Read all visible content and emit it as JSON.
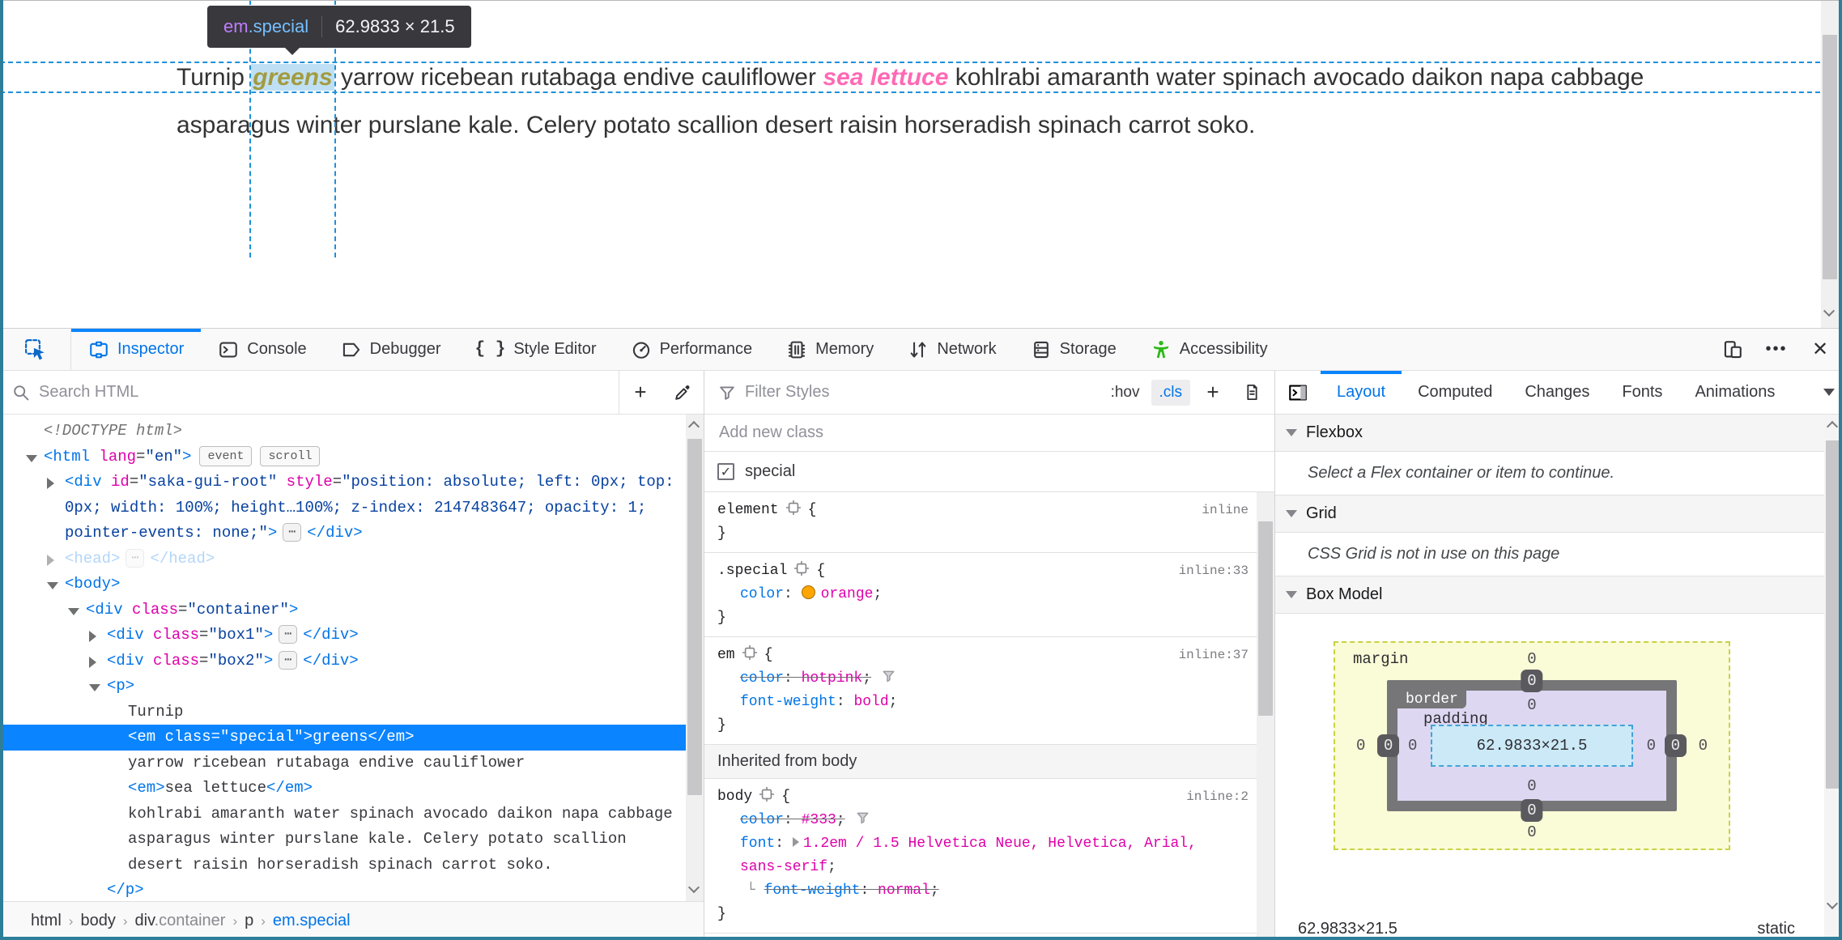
{
  "page": {
    "tooltip": {
      "tag": "em",
      "class": ".special",
      "dims": "62.9833 × 21.5"
    },
    "paragraph": {
      "t1": "Turnip ",
      "em_special": "greens",
      "t2": " yarrow ricebean rutabaga endive cauliflower ",
      "em_plain": "sea lettuce",
      "t3": " kohlrabi amaranth water spinach avocado daikon napa cabbage asparagus winter purslane kale. Celery potato scallion desert raisin horseradish spinach carrot soko."
    }
  },
  "toolbox": {
    "tabs": [
      {
        "icon": "inspector-icon",
        "label": "Inspector",
        "active": true
      },
      {
        "icon": "console-icon",
        "label": "Console"
      },
      {
        "icon": "debugger-icon",
        "label": "Debugger"
      },
      {
        "icon": "style-editor-icon",
        "label": "Style Editor"
      },
      {
        "icon": "performance-icon",
        "label": "Performance"
      },
      {
        "icon": "memory-icon",
        "label": "Memory"
      },
      {
        "icon": "network-icon",
        "label": "Network"
      },
      {
        "icon": "storage-icon",
        "label": "Storage"
      },
      {
        "icon": "accessibility-icon",
        "label": "Accessibility"
      }
    ]
  },
  "markup": {
    "search_placeholder": "Search HTML",
    "tree": [
      {
        "indent": 0,
        "tokens": [
          {
            "t": "doctype",
            "s": "<!DOCTYPE html>"
          }
        ]
      },
      {
        "indent": 0,
        "arrow": "down",
        "tokens": [
          {
            "t": "tag",
            "s": "<html"
          },
          {
            "t": "attr",
            "s": " lang"
          },
          {
            "t": "eq",
            "s": "="
          },
          {
            "t": "val",
            "s": "\"en\""
          },
          {
            "t": "tag",
            "s": ">"
          },
          {
            "t": "badge",
            "s": "event"
          },
          {
            "t": "badge",
            "s": "scroll"
          }
        ]
      },
      {
        "indent": 1,
        "arrow": "right",
        "tokens": [
          {
            "t": "tag",
            "s": "<div"
          },
          {
            "t": "attr",
            "s": " id"
          },
          {
            "t": "eq",
            "s": "="
          },
          {
            "t": "val",
            "s": "\"saka-gui-root\""
          },
          {
            "t": "attr",
            "s": " style"
          },
          {
            "t": "eq",
            "s": "="
          },
          {
            "t": "val",
            "s": "\"position: absolute; left: 0px; top: 0px; width: 100%; height…100%; z-index: 2147483647; opacity: 1; pointer-events: none;\""
          },
          {
            "t": "tag",
            "s": ">"
          },
          {
            "t": "ellipsis",
            "s": "⋯"
          },
          {
            "t": "tag",
            "s": "</div>"
          }
        ]
      },
      {
        "indent": 1,
        "arrow": "right",
        "dim": true,
        "tokens": [
          {
            "t": "tag",
            "s": "<head>"
          },
          {
            "t": "ellipsis",
            "s": "⋯"
          },
          {
            "t": "tag",
            "s": "</head>"
          }
        ]
      },
      {
        "indent": 1,
        "arrow": "down",
        "tokens": [
          {
            "t": "tag",
            "s": "<body>"
          }
        ]
      },
      {
        "indent": 2,
        "arrow": "down",
        "tokens": [
          {
            "t": "tag",
            "s": "<div"
          },
          {
            "t": "attr",
            "s": " class"
          },
          {
            "t": "eq",
            "s": "="
          },
          {
            "t": "val",
            "s": "\"container\""
          },
          {
            "t": "tag",
            "s": ">"
          }
        ]
      },
      {
        "indent": 3,
        "arrow": "right",
        "tokens": [
          {
            "t": "tag",
            "s": "<div"
          },
          {
            "t": "attr",
            "s": " class"
          },
          {
            "t": "eq",
            "s": "="
          },
          {
            "t": "val",
            "s": "\"box1\""
          },
          {
            "t": "tag",
            "s": ">"
          },
          {
            "t": "ellipsis",
            "s": "⋯"
          },
          {
            "t": "tag",
            "s": "</div>"
          }
        ]
      },
      {
        "indent": 3,
        "arrow": "right",
        "tokens": [
          {
            "t": "tag",
            "s": "<div"
          },
          {
            "t": "attr",
            "s": " class"
          },
          {
            "t": "eq",
            "s": "="
          },
          {
            "t": "val",
            "s": "\"box2\""
          },
          {
            "t": "tag",
            "s": ">"
          },
          {
            "t": "ellipsis",
            "s": "⋯"
          },
          {
            "t": "tag",
            "s": "</div>"
          }
        ]
      },
      {
        "indent": 3,
        "arrow": "down",
        "tokens": [
          {
            "t": "tag",
            "s": "<p>"
          }
        ]
      },
      {
        "indent": 4,
        "tokens": [
          {
            "t": "text",
            "s": "Turnip"
          }
        ]
      },
      {
        "indent": 4,
        "selected": true,
        "tokens": [
          {
            "t": "tag",
            "s": "<em"
          },
          {
            "t": "attr",
            "s": " class"
          },
          {
            "t": "eq",
            "s": "="
          },
          {
            "t": "val",
            "s": "\"special\""
          },
          {
            "t": "tag",
            "s": ">"
          },
          {
            "t": "text",
            "s": "greens"
          },
          {
            "t": "tag",
            "s": "</em>"
          }
        ]
      },
      {
        "indent": 4,
        "tokens": [
          {
            "t": "text",
            "s": "yarrow ricebean rutabaga endive cauliflower"
          }
        ]
      },
      {
        "indent": 4,
        "tokens": [
          {
            "t": "tag",
            "s": "<em>"
          },
          {
            "t": "text",
            "s": "sea lettuce"
          },
          {
            "t": "tag",
            "s": "</em>"
          }
        ]
      },
      {
        "indent": 4,
        "tokens": [
          {
            "t": "text",
            "s": "kohlrabi amaranth water spinach avocado daikon napa cabbage asparagus winter purslane kale. Celery potato scallion desert raisin horseradish spinach carrot soko."
          }
        ]
      },
      {
        "indent": 3,
        "tokens": [
          {
            "t": "tag",
            "s": "</p>"
          }
        ]
      }
    ],
    "breadcrumbs": [
      {
        "main": "html"
      },
      {
        "main": "body"
      },
      {
        "main": "div",
        "sub": ".container"
      },
      {
        "main": "p"
      },
      {
        "main": "em.special",
        "selected": true
      }
    ]
  },
  "rules": {
    "filter_placeholder": "Filter Styles",
    "pseudo_button": ":hov",
    "class_button": ".cls",
    "add_class_placeholder": "Add new class",
    "class_toggle": "special",
    "sections": [
      {
        "type": "rule",
        "selector": "element",
        "link": "inline",
        "decls": []
      },
      {
        "type": "rule",
        "selector": ".special",
        "link": "inline:33",
        "decls": [
          {
            "name": "color",
            "value": "orange",
            "swatch": "#ffa500"
          }
        ]
      },
      {
        "type": "rule",
        "selector": "em",
        "link": "inline:37",
        "decls": [
          {
            "name": "color",
            "value": "hotpink",
            "overridden": true,
            "funnel": true
          },
          {
            "name": "font-weight",
            "value": "bold"
          }
        ]
      },
      {
        "type": "header",
        "label": "Inherited from body"
      },
      {
        "type": "rule",
        "selector": "body",
        "link": "inline:2",
        "decls": [
          {
            "name": "color",
            "value": "#333",
            "overridden": true,
            "funnel": true
          },
          {
            "name": "font",
            "value": "1.2em / 1.5 Helvetica Neue, Helvetica, Arial,\nsans-serif",
            "expandable": true
          },
          {
            "name": "font-weight",
            "value": "normal",
            "overridden": true,
            "sub": true
          }
        ]
      }
    ]
  },
  "layout": {
    "tabs": [
      {
        "label": "Layout",
        "active": true
      },
      {
        "label": "Computed"
      },
      {
        "label": "Changes"
      },
      {
        "label": "Fonts"
      },
      {
        "label": "Animations"
      }
    ],
    "flexbox_title": "Flexbox",
    "flexbox_message": "Select a Flex container or item to continue.",
    "grid_title": "Grid",
    "grid_message": "CSS Grid is not in use on this page",
    "boxmodel_title": "Box Model",
    "box_model": {
      "margin_label": "margin",
      "border_label": "border",
      "padding_label": "padding",
      "margin": {
        "top": "0",
        "right": "0",
        "bottom": "0",
        "left": "0"
      },
      "border": {
        "top": "0",
        "right": "0",
        "bottom": "0",
        "left": "0"
      },
      "padding": {
        "top": "0",
        "right": "0",
        "bottom": "0",
        "left": "0"
      },
      "content": "62.9833×21.5"
    },
    "footer": {
      "dimensions": "62.9833×21.5",
      "position": "static"
    }
  }
}
